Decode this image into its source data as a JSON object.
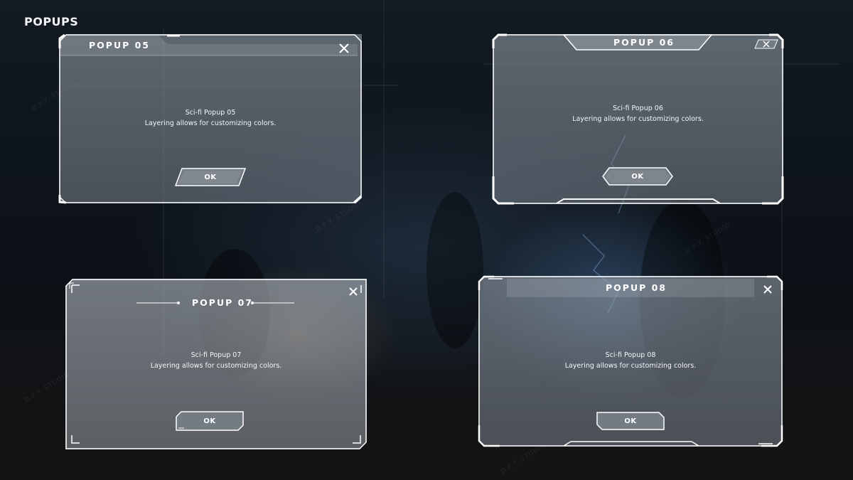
{
  "page": {
    "title": "POPUPS"
  },
  "watermark": "D.F.Y. STUDIO",
  "popups": [
    {
      "title": "POPUP 05",
      "line1": "Sci-fi Popup 05",
      "line2": "Layering allows for customizing colors.",
      "ok": "OK"
    },
    {
      "title": "POPUP 06",
      "line1": "Sci-fi Popup 06",
      "line2": "Layering allows for customizing colors.",
      "ok": "OK"
    },
    {
      "title": "POPUP 07",
      "line1": "Sci-fi Popup 07",
      "line2": "Layering allows for customizing colors.",
      "ok": "OK"
    },
    {
      "title": "POPUP 08",
      "line1": "Sci-fi Popup 08",
      "line2": "Layering allows for customizing colors.",
      "ok": "OK"
    }
  ],
  "colors": {
    "frame": "#ffffff",
    "panel": "#8c96a0",
    "button": "#6b737b"
  }
}
